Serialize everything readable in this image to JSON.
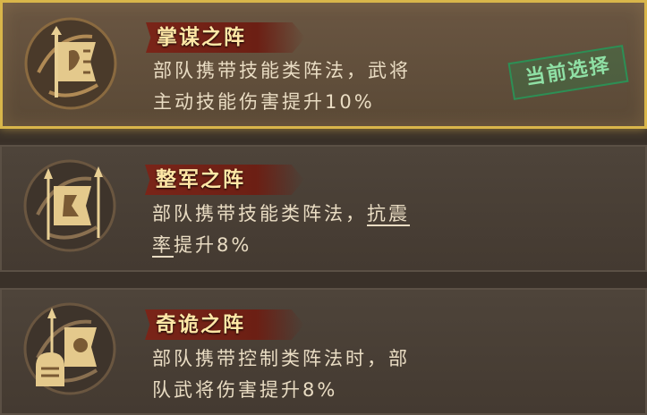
{
  "formations": [
    {
      "title": "掌谋之阵",
      "desc_line1": "部队携带技能类阵法，武将",
      "desc_line2": "主动技能伤害提升10%",
      "selected": true,
      "badge": "当前选择",
      "icon": "flag-banner-emblem-icon"
    },
    {
      "title": "整军之阵",
      "desc_line1_a": "部队携带技能类阵法，",
      "desc_line1_b": "抗震",
      "desc_line2_a": "率",
      "desc_line2_b": "提升8%",
      "selected": false,
      "icon": "spear-banner-emblem-icon"
    },
    {
      "title": "奇诡之阵",
      "desc_line1": "部队携带控制类阵法时，部",
      "desc_line2": "队武将伤害提升8%",
      "selected": false,
      "icon": "helmet-banner-emblem-icon"
    }
  ],
  "colors": {
    "selected_border": "#d9b64a",
    "ribbon": "#7a2418",
    "badge_green": "#2d8f55"
  }
}
